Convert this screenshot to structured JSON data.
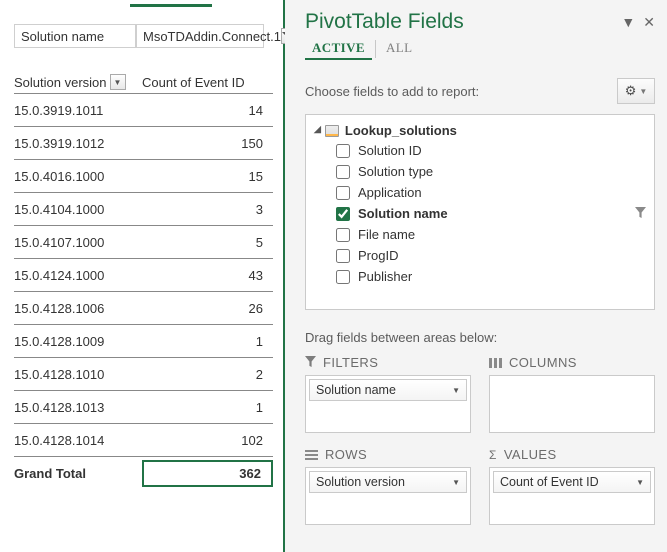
{
  "pivot": {
    "filter_label": "Solution name",
    "filter_value": "MsoTDAddin.Connect.1",
    "col1_header": "Solution version",
    "col2_header": "Count of Event ID",
    "rows": [
      {
        "ver": "15.0.3919.1011",
        "count": "14"
      },
      {
        "ver": "15.0.3919.1012",
        "count": "150"
      },
      {
        "ver": "15.0.4016.1000",
        "count": "15"
      },
      {
        "ver": "15.0.4104.1000",
        "count": "3"
      },
      {
        "ver": "15.0.4107.1000",
        "count": "5"
      },
      {
        "ver": "15.0.4124.1000",
        "count": "43"
      },
      {
        "ver": "15.0.4128.1006",
        "count": "26"
      },
      {
        "ver": "15.0.4128.1009",
        "count": "1"
      },
      {
        "ver": "15.0.4128.1010",
        "count": "2"
      },
      {
        "ver": "15.0.4128.1013",
        "count": "1"
      },
      {
        "ver": "15.0.4128.1014",
        "count": "102"
      }
    ],
    "total_label": "Grand Total",
    "total_value": "362"
  },
  "pane": {
    "title": "PivotTable Fields",
    "tab_active": "ACTIVE",
    "tab_all": "ALL",
    "choose_label": "Choose fields to add to report:",
    "table_name": "Lookup_solutions",
    "fields": [
      {
        "label": "Solution ID",
        "checked": false,
        "funnel": false
      },
      {
        "label": "Solution type",
        "checked": false,
        "funnel": false
      },
      {
        "label": "Application",
        "checked": false,
        "funnel": false
      },
      {
        "label": "Solution name",
        "checked": true,
        "funnel": true
      },
      {
        "label": "File name",
        "checked": false,
        "funnel": false
      },
      {
        "label": "ProgID",
        "checked": false,
        "funnel": false
      },
      {
        "label": "Publisher",
        "checked": false,
        "funnel": false
      }
    ],
    "drag_label": "Drag fields between areas below:",
    "areas": {
      "filters": {
        "title": "FILTERS",
        "item": "Solution name"
      },
      "columns": {
        "title": "COLUMNS",
        "item": ""
      },
      "rows": {
        "title": "ROWS",
        "item": "Solution version"
      },
      "values": {
        "title": "VALUES",
        "item": "Count of Event ID"
      }
    }
  }
}
